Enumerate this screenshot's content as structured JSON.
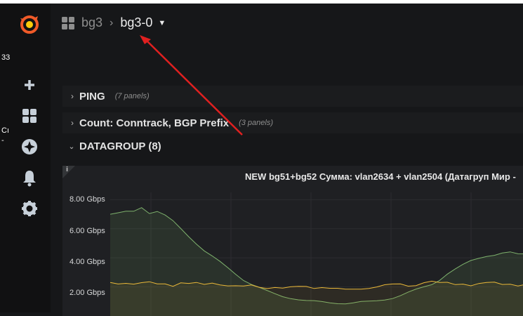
{
  "sidebar": {
    "items": [
      {
        "icon": "grafana-logo-icon"
      },
      {
        "icon": "plus-icon"
      },
      {
        "icon": "dashboards-grid-icon"
      },
      {
        "icon": "explore-compass-icon"
      },
      {
        "icon": "bell-alert-icon"
      },
      {
        "icon": "gear-icon"
      }
    ],
    "gutter_texts": [
      "33",
      "Cı",
      "-"
    ]
  },
  "breadcrumb": {
    "folder": "bg3",
    "dashboard": "bg3-0"
  },
  "rows": [
    {
      "title": "PING",
      "meta": "(7 panels)",
      "collapsed": true
    },
    {
      "title": "Count: Conntrack, BGP Prefix",
      "meta": "(3 panels)",
      "collapsed": true
    },
    {
      "title": "DATAGROUP (8)",
      "meta": "",
      "collapsed": false
    }
  ],
  "panel": {
    "info_icon": "i",
    "title": "NEW bg51+bg52 Сумма: vlan2634 + vlan2504 (Датагруп Мир -",
    "y_ticks": [
      "8.00 Gbps",
      "6.00 Gbps",
      "4.00 Gbps",
      "2.00 Gbps"
    ]
  },
  "chart_data": {
    "type": "line",
    "ylim": [
      0,
      8.5
    ],
    "y_unit": "Gbps",
    "series": [
      {
        "color": "#7eb26d",
        "values": [
          7.0,
          7.05,
          7.15,
          7.2,
          7.5,
          7.1,
          7.2,
          6.9,
          6.5,
          6.0,
          5.5,
          5.0,
          4.5,
          4.1,
          3.7,
          3.3,
          2.9,
          2.5,
          2.2,
          1.95,
          1.7,
          1.5,
          1.35,
          1.25,
          1.15,
          1.05,
          1.0,
          0.95,
          0.92,
          0.9,
          0.88,
          0.9,
          0.95,
          0.98,
          1.05,
          1.15,
          1.25,
          1.4,
          1.6,
          1.8,
          2.0,
          2.2,
          2.5,
          2.9,
          3.2,
          3.5,
          3.8,
          4.0,
          4.15,
          4.2,
          4.3,
          4.35,
          4.25,
          4.3
        ]
      },
      {
        "color": "#eab839",
        "values": [
          2.3,
          2.25,
          2.3,
          2.2,
          2.25,
          2.3,
          2.2,
          2.25,
          2.1,
          2.3,
          2.2,
          2.25,
          2.15,
          2.3,
          2.2,
          2.1,
          2.05,
          2.0,
          2.1,
          2.0,
          1.95,
          2.0,
          1.9,
          1.95,
          2.0,
          2.05,
          1.95,
          2.0,
          1.9,
          1.85,
          1.8,
          1.85,
          1.9,
          1.95,
          2.0,
          2.1,
          2.15,
          2.2,
          2.1,
          2.15,
          2.3,
          2.35,
          2.25,
          2.3,
          2.2,
          2.25,
          2.1,
          2.2,
          2.25,
          2.3,
          2.2,
          2.25,
          2.1,
          2.15
        ]
      }
    ]
  },
  "colors": {
    "accent_arrow": "#e02020",
    "series_green": "#7eb26d",
    "series_yellow": "#eab839"
  }
}
